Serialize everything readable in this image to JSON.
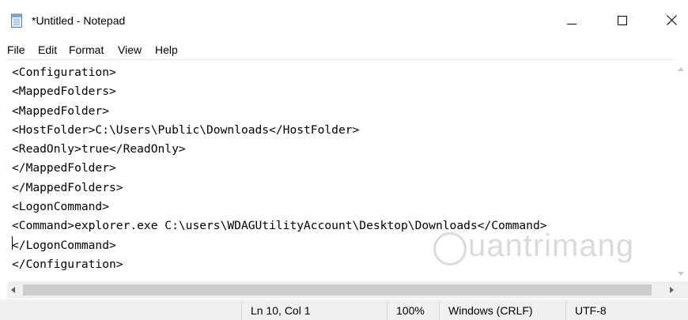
{
  "window": {
    "title": "*Untitled - Notepad"
  },
  "menu": {
    "items": [
      "File",
      "Edit",
      "Format",
      "View",
      "Help"
    ]
  },
  "editor": {
    "lines": [
      "<Configuration>",
      "<MappedFolders>",
      "<MappedFolder>",
      "<HostFolder>C:\\Users\\Public\\Downloads</HostFolder>",
      "<ReadOnly>true</ReadOnly>",
      "</MappedFolder>",
      "</MappedFolders>",
      "<LogonCommand>",
      "<Command>explorer.exe C:\\users\\WDAGUtilityAccount\\Desktop\\Downloads</Command>",
      "</LogonCommand>",
      "</Configuration>"
    ],
    "watermark": "uantrimang"
  },
  "status": {
    "position": "Ln 10, Col 1",
    "zoom": "100%",
    "line_ending": "Windows (CRLF)",
    "encoding": "UTF-8"
  },
  "icons": {
    "app": "notepad-icon",
    "minimize": "minimize-icon",
    "maximize": "maximize-icon",
    "close": "close-icon"
  }
}
